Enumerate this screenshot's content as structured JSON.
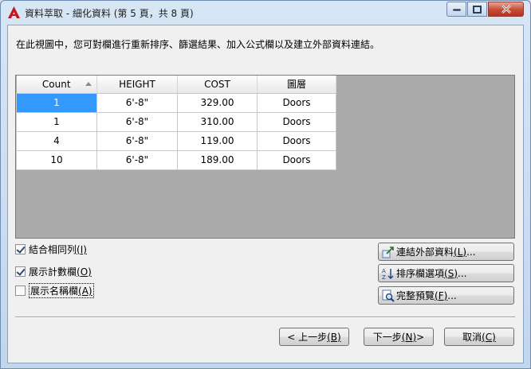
{
  "window": {
    "title": "資料萃取 - 細化資料 (第 5 頁，共 8 頁)",
    "app_icon_letter": "A",
    "app_icon_color": "#c4161c"
  },
  "description": "在此視圖中，您可對欄進行重新排序、篩選結果、加入公式欄以及建立外部資料連結。",
  "table": {
    "columns": [
      "Count",
      "HEIGHT",
      "COST",
      "圖層"
    ],
    "sorted_column": "Count",
    "sort_direction": "ascending",
    "rows": [
      [
        "1",
        "6'-8\"",
        "329.00",
        "Doors"
      ],
      [
        "1",
        "6'-8\"",
        "310.00",
        "Doors"
      ],
      [
        "4",
        "6'-8\"",
        "119.00",
        "Doors"
      ],
      [
        "10",
        "6'-8\"",
        "189.00",
        "Doors"
      ]
    ],
    "selected_cell": {
      "row": 0,
      "col": 0
    }
  },
  "options": {
    "combine": {
      "label": "結合相同列",
      "key": "(I)",
      "checked": true
    },
    "show_count": {
      "label": "展示計數欄",
      "key": "(O)",
      "checked": true
    },
    "show_name": {
      "label": "展示名稱欄",
      "key": "(A)",
      "checked": false
    }
  },
  "side_buttons": {
    "link_external": {
      "label": "連結外部資料",
      "key": "(L)",
      "suffix": "..."
    },
    "sort_options": {
      "label": "排序欄選項",
      "key": "(S)",
      "suffix": "..."
    },
    "full_preview": {
      "label": "完整預覽",
      "key": "(F)",
      "suffix": "..."
    }
  },
  "footer": {
    "back": {
      "prefix": "< 上一步",
      "key": "(B)"
    },
    "next": {
      "prefix": "下一步",
      "key": "(N)",
      "suffix": " >"
    },
    "cancel": {
      "prefix": "取消",
      "key": "(C)"
    }
  }
}
